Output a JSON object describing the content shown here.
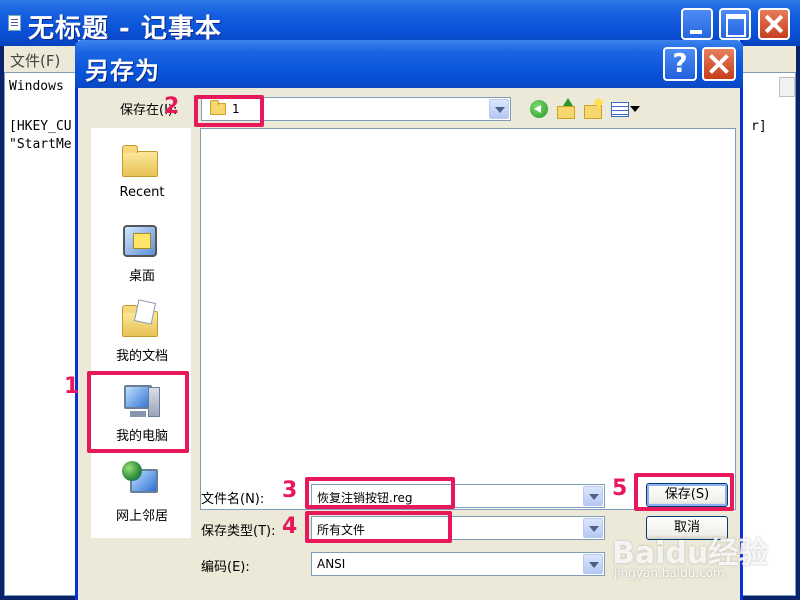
{
  "notepad": {
    "title": "无标题 - 记事本",
    "menu_file": "文件(F)",
    "lines": {
      "line1": "Windows",
      "line3": "[HKEY_CU",
      "line4": "\"StartMe",
      "right_bracket": "r]"
    }
  },
  "dialog": {
    "title": "另存为",
    "help_label": "?",
    "save_in_label": "保存在(I):",
    "save_in_value": "1",
    "places": [
      {
        "label": "Recent",
        "icon": "recent-folder-icon"
      },
      {
        "label": "桌面",
        "icon": "desktop-icon"
      },
      {
        "label": "我的文档",
        "icon": "my-documents-icon"
      },
      {
        "label": "我的电脑",
        "icon": "my-computer-icon"
      },
      {
        "label": "网上邻居",
        "icon": "network-places-icon"
      }
    ],
    "filename_label": "文件名(N):",
    "filename_value": "恢复注销按钮.reg",
    "filetype_label": "保存类型(T):",
    "filetype_value": "所有文件",
    "encoding_label": "编码(E):",
    "encoding_value": "ANSI",
    "save_button": "保存(S)",
    "cancel_button": "取消"
  },
  "annotations": {
    "markers": [
      "1",
      "2",
      "3",
      "4",
      "5"
    ],
    "color": "#e8195a"
  },
  "watermark": {
    "brand": "Baidu经验",
    "url": "jingyan.baidu.com"
  },
  "colors": {
    "titlebar": "#0a50d6",
    "dialog_bg": "#ece9d8",
    "marker": "#e8195a"
  }
}
